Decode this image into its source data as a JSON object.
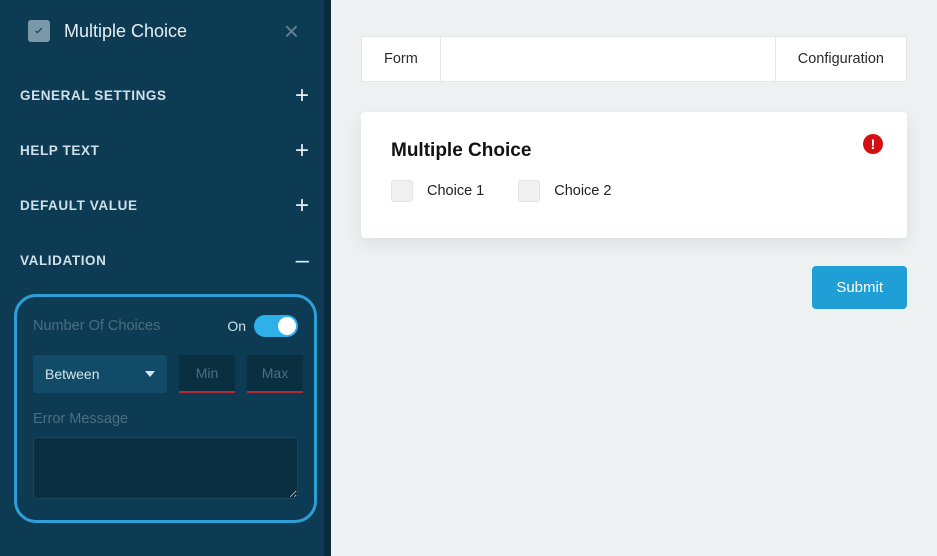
{
  "sidebar": {
    "title": "Multiple Choice",
    "sections": {
      "general": {
        "label": "GENERAL SETTINGS",
        "collapsed": true
      },
      "help": {
        "label": "HELP TEXT",
        "collapsed": true
      },
      "default": {
        "label": "DEFAULT VALUE",
        "collapsed": true
      },
      "validation": {
        "label": "VALIDATION",
        "collapsed": false
      }
    },
    "validation": {
      "num_choices_label": "Number Of Choices",
      "toggle_label": "On",
      "toggle_on": true,
      "operator": "Between",
      "min_placeholder": "Min",
      "max_placeholder": "Max",
      "min_value": "",
      "max_value": "",
      "error_message_label": "Error Message",
      "error_message_value": ""
    }
  },
  "main": {
    "tabs": [
      {
        "label": "Form"
      },
      {
        "label": "Configuration"
      }
    ],
    "card": {
      "title": "Multiple Choice",
      "has_alert": true,
      "choices": [
        {
          "label": "Choice 1"
        },
        {
          "label": "Choice 2"
        }
      ]
    },
    "submit_label": "Submit"
  },
  "icons": {
    "field_type": "checkbox-icon",
    "close": "close-icon",
    "expand": "plus-icon",
    "collapse": "minus-icon",
    "alert": "alert-icon",
    "dropdown": "chevron-down-icon"
  }
}
